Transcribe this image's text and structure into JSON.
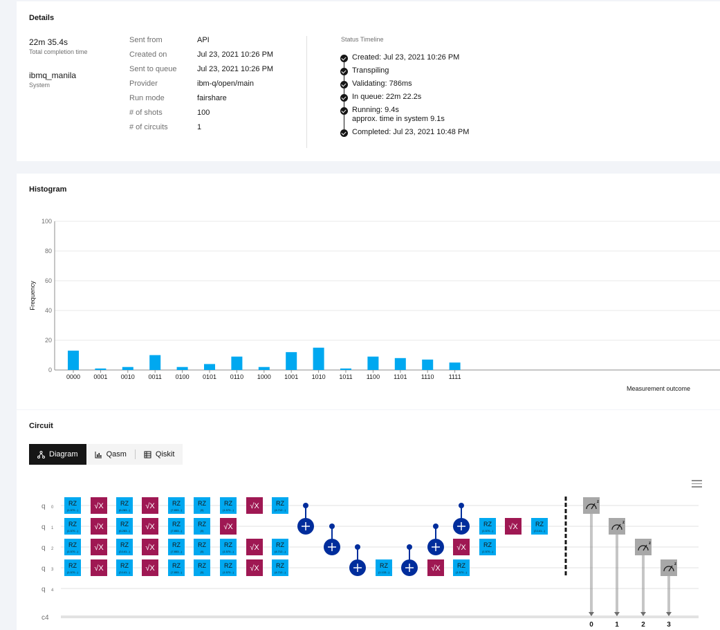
{
  "details": {
    "title": "Details",
    "completion_value": "22m 35.4s",
    "completion_label": "Total completion time",
    "system_value": "ibmq_manila",
    "system_label": "System",
    "fields": [
      {
        "label": "Sent from",
        "value": "API"
      },
      {
        "label": "Created on",
        "value": "Jul 23, 2021 10:26 PM"
      },
      {
        "label": "Sent to queue",
        "value": "Jul 23, 2021 10:26 PM"
      },
      {
        "label": "Provider",
        "value": "ibm-q/open/main"
      },
      {
        "label": "Run mode",
        "value": "fairshare"
      },
      {
        "label": "# of shots",
        "value": "100"
      },
      {
        "label": "# of circuits",
        "value": "1"
      }
    ],
    "timeline_title": "Status Timeline",
    "timeline": [
      {
        "text": "Created: Jul 23, 2021 10:26 PM"
      },
      {
        "text": "Transpiling"
      },
      {
        "text": "Validating: 786ms"
      },
      {
        "text": "In queue: 22m 22.2s"
      },
      {
        "text": "Running: 9.4s",
        "sub": "approx. time in system 9.1s"
      },
      {
        "text": "Completed: Jul 23, 2021 10:48 PM"
      }
    ]
  },
  "histogram": {
    "title": "Histogram"
  },
  "chart_data": {
    "type": "bar",
    "categories": [
      "0000",
      "0001",
      "0010",
      "0011",
      "0100",
      "0101",
      "0110",
      "1000",
      "1001",
      "1010",
      "1011",
      "1100",
      "1101",
      "1110",
      "1111"
    ],
    "values": [
      13,
      1,
      2,
      10,
      2,
      4,
      9,
      2,
      12,
      15,
      1,
      9,
      8,
      7,
      5
    ],
    "ylabel": "Frequency",
    "xlabel": "Measurement outcome",
    "ylim": [
      0,
      100
    ],
    "yticks": [
      0,
      20,
      40,
      60,
      80,
      100
    ],
    "grid": true,
    "bar_color": "#00a8f0"
  },
  "circuit": {
    "title": "Circuit",
    "tabs": [
      {
        "label": "Diagram",
        "icon": "diagram-icon",
        "active": true
      },
      {
        "label": "Qasm",
        "icon": "chart-icon",
        "active": false
      },
      {
        "label": "Qiskit",
        "icon": "table-icon",
        "active": false
      }
    ],
    "qubits": [
      "q 0",
      "q 1",
      "q 2",
      "q 3",
      "q 4"
    ],
    "qubit_labels": [
      "q",
      "q",
      "q",
      "q",
      "q"
    ],
    "qubit_indices": [
      "0",
      "1",
      "2",
      "3",
      "4"
    ],
    "classical_label": "c4",
    "classical_bits": [
      "0",
      "1",
      "2",
      "3"
    ],
    "gates": {
      "rz": "RZ",
      "sx": "√X",
      "params": [
        "(1.570...)",
        "(6.283...)",
        "(3.141...)",
        "(7.853...)",
        "(0)",
        "(4.712...)",
        "(1.133...)"
      ]
    },
    "colors": {
      "rz": "#00a8f0",
      "sx": "#9f1853",
      "cx": "#002d9c",
      "measure": "#a8a8a8"
    }
  }
}
